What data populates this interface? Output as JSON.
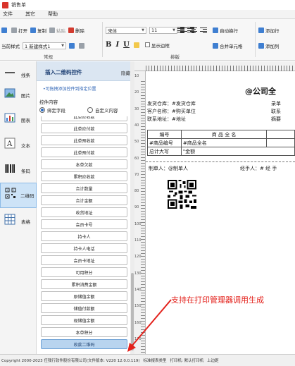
{
  "window": {
    "title": "销售单"
  },
  "menu": [
    "文件",
    "其它",
    "帮助"
  ],
  "ribbon": {
    "common": {
      "open": "打开",
      "copy": "复制",
      "paste": "粘贴",
      "delete": "删除",
      "current_style_label": "当前样式",
      "current_style_value": "1 新建样式1",
      "group_label": "常规"
    },
    "format": {
      "font": "宋体",
      "size": "11",
      "bold": "B",
      "italic": "I",
      "underline": "U",
      "show_border": "显示边框",
      "group_label": "排版",
      "auto_wrap": "自动换行",
      "merge_cells": "合并单元格"
    },
    "insert": {
      "add_row": "添加行",
      "add_column": "添加列"
    }
  },
  "leftnav": [
    {
      "label": "线条",
      "icon": "line-icon"
    },
    {
      "label": "图片",
      "icon": "image-icon"
    },
    {
      "label": "图表",
      "icon": "chart-icon"
    },
    {
      "label": "文本",
      "icon": "text-icon"
    },
    {
      "label": "条码",
      "icon": "barcode-icon"
    },
    {
      "label": "二维码",
      "icon": "qrcode-icon",
      "active": true
    },
    {
      "label": "表格",
      "icon": "table-icon"
    }
  ],
  "panel": {
    "title": "插入二维码控件",
    "hide": "隐藏",
    "hint": "•可拖拽添加控件到指定位置",
    "content_label": "控件内容",
    "radio_bound": "绑定字段",
    "radio_custom": "自定义内容",
    "fields": [
      "此单应收款",
      "此单应付款",
      "此单预收款",
      "此单预付款",
      "本单欠款",
      "累积应收款",
      "合计数量",
      "合计金额",
      "收货地址",
      "会员卡号",
      "持卡人",
      "持卡人电话",
      "会员卡地址",
      "可用积分",
      "累积消费金额",
      "原储值余额",
      "储值付款额",
      "现储值余额",
      "本单积分",
      "收款二维码"
    ],
    "selected_field": "收款二维码"
  },
  "ruler": {
    "v_labels": [
      "10",
      "20",
      "30",
      "40",
      "50",
      "60",
      "70",
      "80",
      "90",
      "100",
      "110",
      "120",
      "130",
      "140",
      "150",
      "160",
      "170"
    ]
  },
  "document": {
    "company": "@公司全",
    "rows": [
      {
        "label": "发货仓库：",
        "value": "#发货仓库",
        "right": "录单"
      },
      {
        "label": "客户名称：",
        "value": "#购买单位",
        "right": "联系"
      },
      {
        "label": "联系地址：",
        "value": "#地址",
        "right": "摘要"
      }
    ],
    "table": {
      "header": [
        "编号",
        "商 品 全 名"
      ],
      "row": [
        "#商品编号",
        "#商品全名"
      ],
      "total_label": "总计大写",
      "total_value": "\"金额"
    },
    "signers": [
      {
        "label": "制单人：",
        "value": "@制单人"
      },
      {
        "label": "经手人：",
        "value": "# 经 手"
      }
    ],
    "promo": "支持在打印管理器调用生成"
  },
  "statusbar": [
    "Copyright 2000-2023 任我行软件股份有限公司(文件版本: V220 12.0.0.119)",
    "标准报表类型",
    "打印机: 默认打印机",
    "上边距"
  ]
}
